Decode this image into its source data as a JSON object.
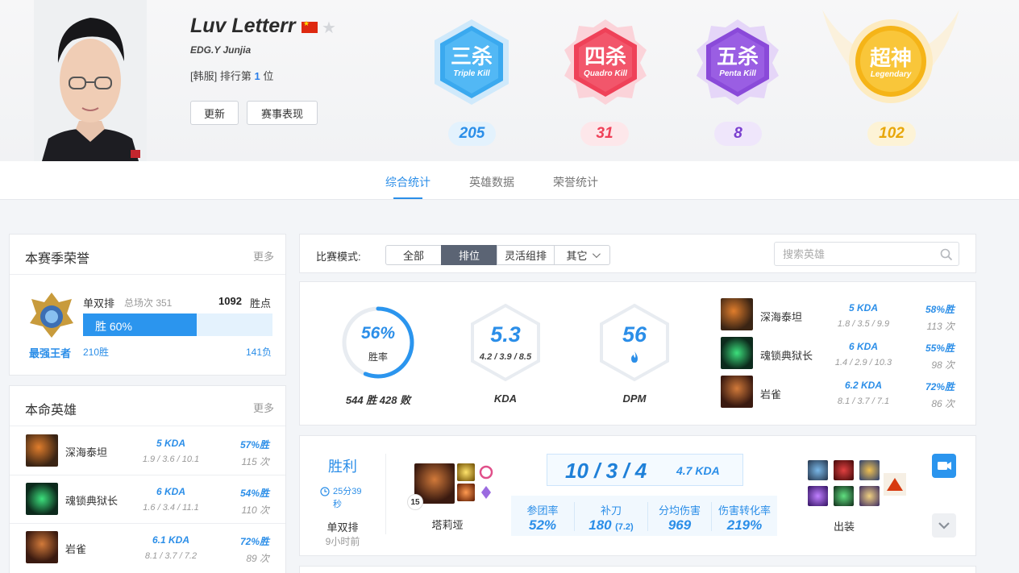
{
  "player": {
    "name": "Luv Letterr",
    "team": "EDG.Y Junjia",
    "region": "[韩服]",
    "rank_prefix": "排行第",
    "rank_num": "1",
    "rank_suffix": "位",
    "update_label": "更新",
    "match_perf_label": "赛事表现"
  },
  "multikills": [
    {
      "cn": "三杀",
      "en": "Triple Kill",
      "count": "205",
      "color": "#3aa9ef"
    },
    {
      "cn": "四杀",
      "en": "Quadro Kill",
      "count": "31",
      "color": "#ef4158"
    },
    {
      "cn": "五杀",
      "en": "Penta Kill",
      "count": "8",
      "color": "#8a4ad9"
    },
    {
      "cn": "超神",
      "en": "Legendary",
      "count": "102",
      "color": "#f5b417"
    }
  ],
  "tabs": [
    "综合统计",
    "英雄数据",
    "荣誉统计"
  ],
  "season_honor": {
    "title": "本赛季荣誉",
    "more": "更多",
    "queue": "单双排",
    "total_label": "总场次 351",
    "points": "1092",
    "points_label": "胜点",
    "win_bar_label": "胜 60%",
    "win_pct": 0.6,
    "tier": "最强王者",
    "wins": "210胜",
    "losses": "141负"
  },
  "main_heroes": {
    "title": "本命英雄",
    "more": "更多",
    "rows": [
      {
        "name": "深海泰坦",
        "kda": "5 KDA",
        "detail": "1.9 / 3.6 / 10.1",
        "wr": "57%胜",
        "games": "115 次"
      },
      {
        "name": "魂锁典狱长",
        "kda": "6 KDA",
        "detail": "1.6 / 3.4 / 11.1",
        "wr": "54%胜",
        "games": "110 次"
      },
      {
        "name": "岩雀",
        "kda": "6.1 KDA",
        "detail": "8.1 / 3.7 / 7.2",
        "wr": "72%胜",
        "games": "89 次"
      }
    ]
  },
  "filter": {
    "mode_label": "比赛模式:",
    "modes": [
      "全部",
      "排位",
      "灵活组排",
      "其它"
    ],
    "search_placeholder": "搜索英雄"
  },
  "overview": {
    "winrate": "56%",
    "winrate_value": 0.56,
    "winrate_label": "胜率",
    "record": "544 胜 428 败",
    "kda": "5.3",
    "kda_detail": "4.2 / 3.9 / 8.5",
    "kda_label": "KDA",
    "dpm": "56",
    "dpm_label": "DPM",
    "heroes": [
      {
        "name": "深海泰坦",
        "kda": "5 KDA",
        "detail": "1.8 / 3.5 / 9.9",
        "wr": "58%胜",
        "games": "113 次"
      },
      {
        "name": "魂锁典狱长",
        "kda": "6 KDA",
        "detail": "1.4 / 2.9 / 10.3",
        "wr": "55%胜",
        "games": "98 次"
      },
      {
        "name": "岩雀",
        "kda": "6.2 KDA",
        "detail": "8.1 / 3.7 / 7.1",
        "wr": "72%胜",
        "games": "86 次"
      }
    ]
  },
  "match": {
    "result": "胜利",
    "duration": "25分39秒",
    "queue": "单双排",
    "ago": "9小时前",
    "level": "15",
    "champion": "塔莉垭",
    "kills": "10",
    "deaths": "3",
    "assists": "4",
    "kda": "4.7 KDA",
    "stats": [
      {
        "label": "参团率",
        "value": "52%"
      },
      {
        "label": "补刀",
        "value": "180",
        "sub": "(7.2)"
      },
      {
        "label": "分均伤害",
        "value": "969"
      },
      {
        "label": "伤害转化率",
        "value": "219%"
      }
    ],
    "items_label": "出装"
  }
}
